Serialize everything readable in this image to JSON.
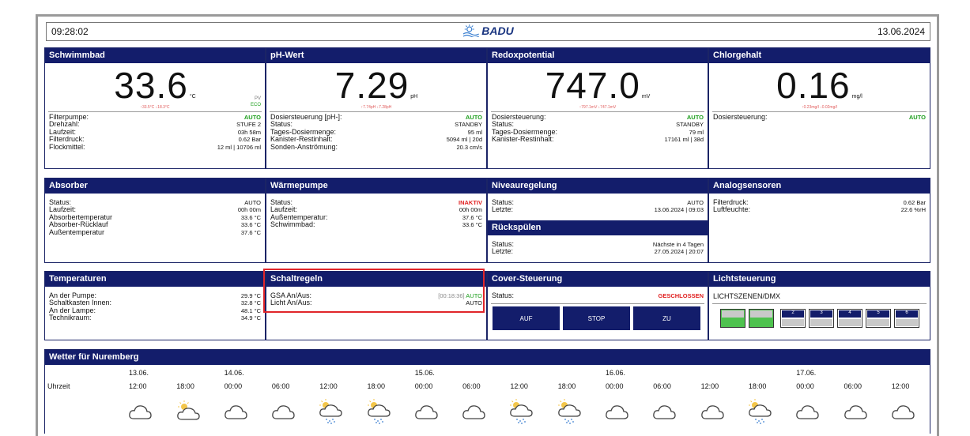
{
  "header": {
    "time": "09:28:02",
    "brand": "BADU",
    "date": "13.06.2024"
  },
  "colors": {
    "header_bg": "#131d6b",
    "auto": "#1c9e1c",
    "alert": "#e02020",
    "highlight": "#e0262a"
  },
  "schwimmbad": {
    "title": "Schwimmbad",
    "value": "33.6",
    "unit": "°C",
    "min_max": "↑33.5°C ↓18.3°C",
    "pv": "PV",
    "eco": "ECO",
    "rows": [
      {
        "label": "Filterpumpe:",
        "value": "AUTO"
      },
      {
        "label": "Drehzahl:",
        "value": "STUFE 2"
      },
      {
        "label": "Laufzeit:",
        "value": "03h 58m"
      },
      {
        "label": "Filterdruck:",
        "value": "0.62 Bar"
      },
      {
        "label": "Flockmittel:",
        "value": "12 ml | 10706 ml"
      }
    ]
  },
  "ph": {
    "title": "pH-Wert",
    "value": "7.29",
    "unit": "pH",
    "min_max": "↑7.74pH ↓7.28pH",
    "rows": [
      {
        "label": "Dosiersteuerung [pH-]:",
        "value": "AUTO"
      },
      {
        "label": "Status:",
        "value": "STANDBY"
      },
      {
        "label": "Tages-Dosiermenge:",
        "value": "95 ml"
      },
      {
        "label": "Kanister-Restinhalt:",
        "value": "5094 ml | 20d"
      },
      {
        "label": "Sonden-Anströmung:",
        "value": "20.3 cm/s"
      }
    ]
  },
  "redox": {
    "title": "Redoxpotential",
    "value": "747.0",
    "unit": "mV",
    "min_max": "↑797.1mV ↓747.1mV",
    "rows": [
      {
        "label": "Dosiersteuerung:",
        "value": "AUTO"
      },
      {
        "label": "Status:",
        "value": "STANDBY"
      },
      {
        "label": "Tages-Dosiermenge:",
        "value": "79 ml"
      },
      {
        "label": "Kanister-Restinhalt:",
        "value": "17161 ml | 38d"
      }
    ]
  },
  "chlor": {
    "title": "Chlorgehalt",
    "value": "0.16",
    "unit": "mg/l",
    "min_max": "↑0.23mg/l ↓0.02mg/l",
    "rows": [
      {
        "label": "Dosiersteuerung:",
        "value": "AUTO"
      }
    ]
  },
  "absorber": {
    "title": "Absorber",
    "rows": [
      {
        "label": "Status:",
        "value": "AUTO"
      },
      {
        "label": "Laufzeit:",
        "value": "00h 00m"
      },
      {
        "label": "Absorbertemperatur",
        "value": "33.6 °C"
      },
      {
        "label": "Absorber-Rücklauf",
        "value": "33.6 °C"
      },
      {
        "label": "Außentemperatur",
        "value": "37.6 °C"
      }
    ]
  },
  "waermepumpe": {
    "title": "Wärmepumpe",
    "rows": [
      {
        "label": "Status:",
        "value": "INAKTIV"
      },
      {
        "label": "Laufzeit:",
        "value": "00h 00m"
      },
      {
        "label": "Außentemperatur:",
        "value": "37.6 °C"
      },
      {
        "label": "Schwimmbad:",
        "value": "33.6 °C"
      }
    ]
  },
  "niveau": {
    "title": "Niveauregelung",
    "rows": [
      {
        "label": "Status:",
        "value": "AUTO"
      },
      {
        "label": "Letzte:",
        "value": "13.06.2024 | 09:03"
      }
    ],
    "sub_title": "Rückspülen",
    "sub_rows": [
      {
        "label": "Status:",
        "value": "Nächste in 4 Tagen"
      },
      {
        "label": "Letzte:",
        "value": "27.05.2024 | 20:07"
      }
    ]
  },
  "analog": {
    "title": "Analogsensoren",
    "rows": [
      {
        "label": "Filterdruck:",
        "value": "0.62 Bar"
      },
      {
        "label": "Luftfeuchte:",
        "value": "22.6 %rH"
      }
    ]
  },
  "temperaturen": {
    "title": "Temperaturen",
    "rows": [
      {
        "label": "An der Pumpe:",
        "value": "29.9 °C"
      },
      {
        "label": "Schaltkasten Innen:",
        "value": "32.8 °C"
      },
      {
        "label": "An der Lampe:",
        "value": "48.1 °C"
      },
      {
        "label": "Technikraum:",
        "value": "34.9 °C"
      }
    ]
  },
  "schaltregeln": {
    "title": "Schaltregeln",
    "rows": [
      {
        "label": "GSA An/Aus:",
        "timer": "[00:18:36]",
        "value": "AUTO"
      },
      {
        "label": "Licht An/Aus:",
        "value": "AUTO"
      }
    ]
  },
  "cover": {
    "title": "Cover-Steuerung",
    "status_label": "Status:",
    "status_value": "GESCHLOSSEN",
    "buttons": [
      "AUF",
      "STOP",
      "ZU"
    ]
  },
  "licht": {
    "title": "Lichtsteuerung",
    "subtitle": "LICHTSZENEN/DMX",
    "scenes": [
      {
        "label": "",
        "active": true
      },
      {
        "label": "",
        "active": true
      },
      {
        "label": "2",
        "active": false
      },
      {
        "label": "3",
        "active": false
      },
      {
        "label": "4",
        "active": false
      },
      {
        "label": "5",
        "active": false
      },
      {
        "label": "6",
        "active": false
      }
    ]
  },
  "wetter": {
    "title": "Wetter für Nuremberg",
    "time_label": "Uhrzeit",
    "dates": [
      "13.06.",
      "14.06.",
      "15.06.",
      "16.06.",
      "17.06."
    ],
    "times": [
      "12:00",
      "18:00",
      "00:00",
      "06:00",
      "12:00",
      "18:00",
      "00:00",
      "06:00",
      "12:00",
      "18:00",
      "00:00",
      "06:00",
      "12:00",
      "18:00",
      "00:00",
      "06:00",
      "12:00"
    ],
    "icons": [
      "cloud",
      "sun-cloud",
      "cloud",
      "cloud",
      "sun-rain",
      "sun-rain",
      "cloud",
      "cloud",
      "sun-rain",
      "sun-rain",
      "cloud",
      "cloud",
      "cloud",
      "sun-rain",
      "cloud",
      "cloud",
      "cloud"
    ]
  }
}
